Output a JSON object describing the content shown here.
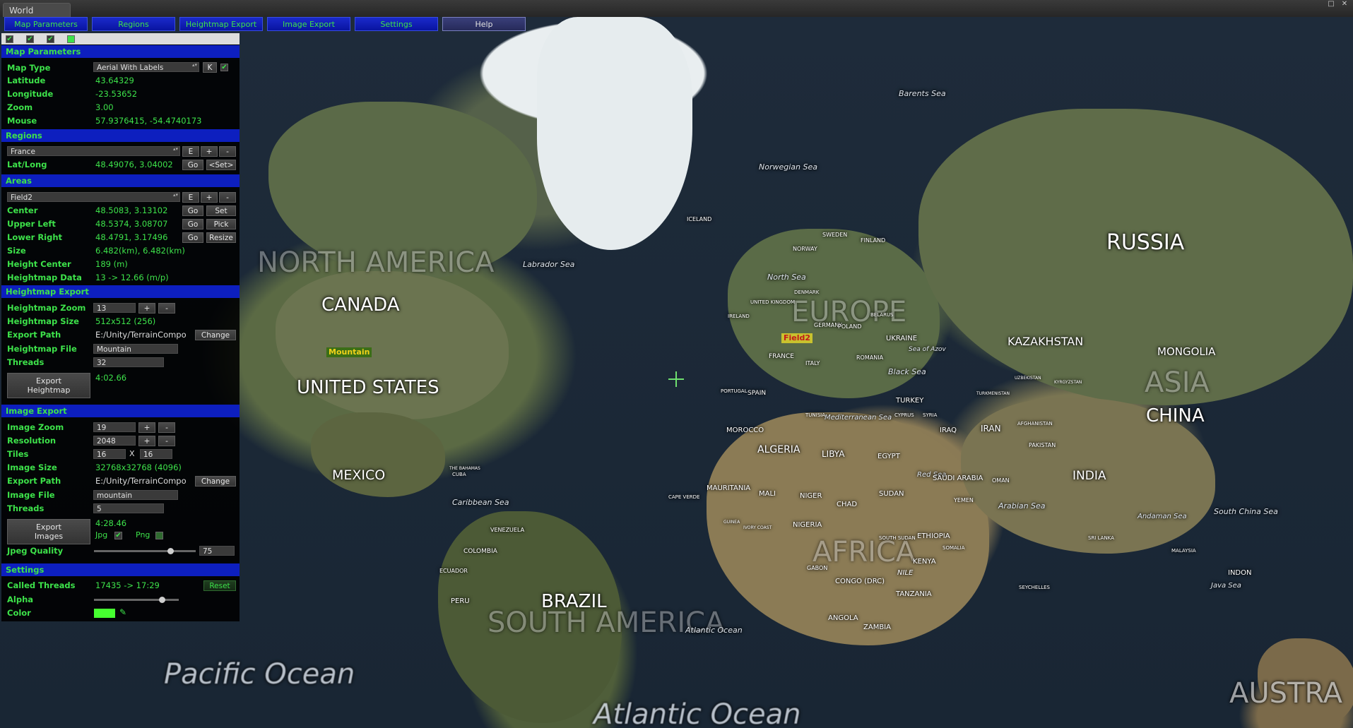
{
  "window": {
    "tab_title": "World",
    "buttons": [
      "□",
      "✕"
    ]
  },
  "menu": {
    "tabs": [
      "Map Parameters",
      "Regions",
      "Heightmap Export",
      "Image Export",
      "Settings",
      "Help"
    ]
  },
  "toggles": [
    "✔",
    "✔",
    "✔",
    ""
  ],
  "map_parameters": {
    "header": "Map Parameters",
    "map_type_label": "Map Type",
    "map_type_value": "Aerial With Labels",
    "k_button": "K",
    "latitude_label": "Latitude",
    "latitude": "43.64329",
    "longitude_label": "Longitude",
    "longitude": "-23.53652",
    "zoom_label": "Zoom",
    "zoom": "3.00",
    "mouse_label": "Mouse",
    "mouse": "57.9376415, -54.4740173"
  },
  "regions": {
    "header": "Regions",
    "selected": "France",
    "btn_e": "E",
    "btn_add": "+",
    "btn_remove": "-",
    "latlong_label": "Lat/Long",
    "latlong": "48.49076, 3.04002",
    "go": "Go",
    "set": "<Set>"
  },
  "areas": {
    "header": "Areas",
    "selected": "Field2",
    "btn_e": "E",
    "btn_add": "+",
    "btn_remove": "-",
    "center_label": "Center",
    "center": "48.5083, 3.13102",
    "upper_left_label": "Upper Left",
    "upper_left": "48.5374, 3.08707",
    "lower_right_label": "Lower Right",
    "lower_right": "48.4791, 3.17496",
    "size_label": "Size",
    "size": "6.482(km), 6.482(km)",
    "height_center_label": "Height Center",
    "height_center": "189 (m)",
    "heightmap_data_label": "Heightmap Data",
    "heightmap_data": "13 -> 12.66 (m/p)",
    "go": "Go",
    "set": "Set",
    "pick": "Pick",
    "resize": "Resize"
  },
  "heightmap_export": {
    "header": "Heightmap Export",
    "zoom_label": "Heightmap Zoom",
    "zoom": "13",
    "size_label": "Heightmap Size",
    "size": "512x512  (256)",
    "path_label": "Export Path",
    "path": "E:/Unity/TerrainCompo",
    "change": "Change",
    "file_label": "Heightmap File",
    "file": "Mountain",
    "threads_label": "Threads",
    "threads": "32",
    "export_button": [
      "Export",
      "Heightmap"
    ],
    "time": "4:02.66",
    "plus": "+",
    "minus": "-"
  },
  "image_export": {
    "header": "Image Export",
    "zoom_label": "Image Zoom",
    "zoom": "19",
    "resolution_label": "Resolution",
    "resolution": "2048",
    "tiles_label": "Tiles",
    "tiles_x": "16",
    "tiles_sep": "X",
    "tiles_y": "16",
    "size_label": "Image Size",
    "size": "32768x32768  (4096)",
    "path_label": "Export Path",
    "path": "E:/Unity/TerrainCompo",
    "change": "Change",
    "file_label": "Image File",
    "file": "mountain",
    "threads_label": "Threads",
    "threads": "5",
    "export_button": [
      "Export",
      "Images"
    ],
    "time": "4:28.46",
    "jpg_label": "Jpg",
    "png_label": "Png",
    "jpeg_quality_label": "Jpeg Quality",
    "jpeg_quality": "75",
    "jpeg_quality_fraction": 0.75,
    "plus": "+",
    "minus": "-"
  },
  "settings": {
    "header": "Settings",
    "called_threads_label": "Called Threads",
    "called_threads": "17435 -> 17:29",
    "reset": "Reset",
    "alpha_label": "Alpha",
    "alpha_fraction": 0.8,
    "color_label": "Color",
    "color": "#46ff30"
  },
  "map": {
    "countries": [
      "CANADA",
      "UNITED STATES",
      "MEXICO",
      "BRAZIL",
      "RUSSIA",
      "KAZAKHSTAN",
      "MONGOLIA",
      "CHINA",
      "INDIA",
      "ALGERIA"
    ],
    "continents": [
      "NORTH AMERICA",
      "SOUTH AMERICA",
      "EUROPE",
      "ASIA",
      "AFRICA",
      "AUSTRA"
    ],
    "oceans": [
      "Pacific Ocean",
      "Atlantic Ocean"
    ],
    "seas": [
      "Barents Sea",
      "Norwegian Sea",
      "Labrador Sea",
      "North Sea",
      "Black Sea",
      "Sea of Azov",
      "Mediterranean Sea",
      "Caribbean Sea",
      "Red Sea",
      "Arabian Sea",
      "South China Sea",
      "Java Sea",
      "Andaman Sea",
      "Atlantic Ocean"
    ],
    "small_countries": [
      "LIBYA",
      "EGYPT",
      "MALI",
      "NIGER",
      "CHAD",
      "SUDAN",
      "NIGERIA",
      "ETHIOPIA",
      "KENYA",
      "TANZANIA",
      "ANGOLA",
      "ZAMBIA",
      "CONGO (DRC)",
      "MAURITANIA",
      "MOROCCO",
      "SAUDI ARABIA",
      "IRAN",
      "IRAQ",
      "TURKEY",
      "UKRAINE",
      "FRANCE",
      "SPAIN",
      "ITALY",
      "GERMANY",
      "POLAND",
      "ROMANIA",
      "FINLAND",
      "SWEDEN",
      "NORWAY",
      "ICELAND",
      "PERU",
      "COLOMBIA",
      "VENEZUELA",
      "ECUADOR",
      "CUBA",
      "PAKISTAN",
      "AFGHANISTAN",
      "YEMEN",
      "OMAN",
      "GABON",
      "SOMALIA",
      "UNITED KINGDOM",
      "IRELAND",
      "PORTUGAL",
      "TUNISIA",
      "DENMARK",
      "BELARUS",
      "SYRIA",
      "CYPRUS",
      "INDON",
      "CAPE VERDE",
      "SEYCHELLES",
      "THE BAHAMAS",
      "GUINEA",
      "IVORY COAST",
      "SOUTH SUDAN",
      "TURKMENISTAN",
      "UZBEKISTAN",
      "MALAYSIA",
      "SRI LANKA",
      "KYRGYZSTAN",
      "NILE"
    ],
    "markers": [
      {
        "label": "Mountain",
        "bg": "#3b6e16",
        "fg": "#f2d21a"
      },
      {
        "label": "Field2",
        "bg": "#c9c22e",
        "fg": "#c21a1a"
      }
    ]
  }
}
